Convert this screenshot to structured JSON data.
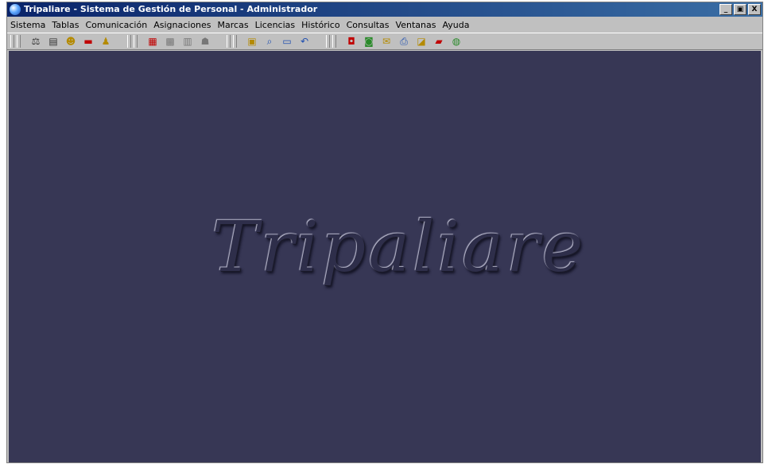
{
  "window": {
    "title": "Tripaliare - Sistema de Gestión de Personal - Administrador",
    "controls": {
      "minimize": "_",
      "maximize": "▣",
      "close": "X"
    }
  },
  "menu": [
    {
      "label": "Sistema"
    },
    {
      "label": "Tablas"
    },
    {
      "label": "Comunicación"
    },
    {
      "label": "Asignaciones"
    },
    {
      "label": "Marcas"
    },
    {
      "label": "Licencias"
    },
    {
      "label": "Histórico"
    },
    {
      "label": "Consultas"
    },
    {
      "label": "Ventanas"
    },
    {
      "label": "Ayuda"
    }
  ],
  "toolbar": {
    "group1": [
      "scale-icon",
      "ruler-icon",
      "people-icon",
      "card-icon",
      "person-icon"
    ],
    "group2": [
      "calendar-icon",
      "grid-icon",
      "document-icon",
      "people-grey-icon"
    ],
    "group3": [
      "folder-icon",
      "search-icon",
      "window-icon",
      "undo-icon"
    ],
    "group4": [
      "report-icon",
      "chart-icon",
      "mail-icon",
      "print-icon",
      "export-icon",
      "display-icon",
      "globe-icon"
    ]
  },
  "workspace": {
    "background": "#373755",
    "logo_text": "Tripaliare"
  }
}
